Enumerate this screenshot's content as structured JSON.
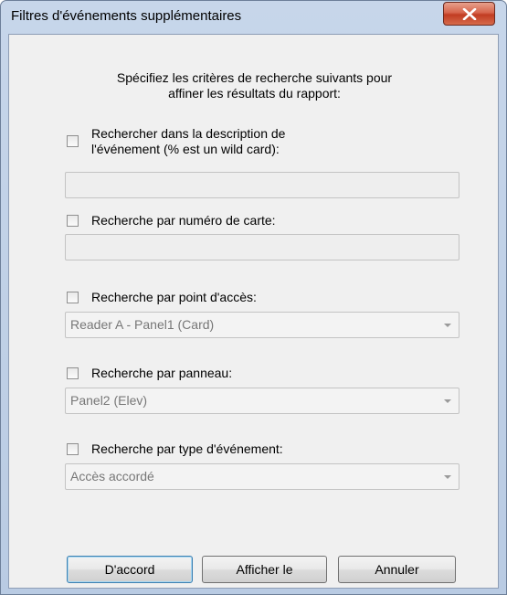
{
  "window": {
    "title": "Filtres d'événements supplémentaires",
    "close_icon": "close-x-icon"
  },
  "intro": {
    "line1": "Spécifiez les critères de recherche suivants pour",
    "line2": "affiner les résultats du rapport:"
  },
  "filters": {
    "description": {
      "label_line1": "Rechercher dans la description de",
      "label_line2": "l'événement (% est un wild card):",
      "checked": false,
      "value": ""
    },
    "card_number": {
      "label": "Recherche par numéro de carte:",
      "checked": false,
      "value": ""
    },
    "access_point": {
      "label": "Recherche par point d'accès:",
      "checked": false,
      "selected": "Reader A - Panel1 (Card)"
    },
    "panel": {
      "label": "Recherche par panneau:",
      "checked": false,
      "selected": "Panel2 (Elev)"
    },
    "event_type": {
      "label": "Recherche par type d'événement:",
      "checked": false,
      "selected": "Accès accordé"
    }
  },
  "buttons": {
    "ok": "D'accord",
    "show": "Afficher le",
    "cancel": "Annuler"
  },
  "colors": {
    "title_bar": "#c7d6ea",
    "client_bg": "#f0f0f0",
    "close_button": "#c94a32"
  }
}
